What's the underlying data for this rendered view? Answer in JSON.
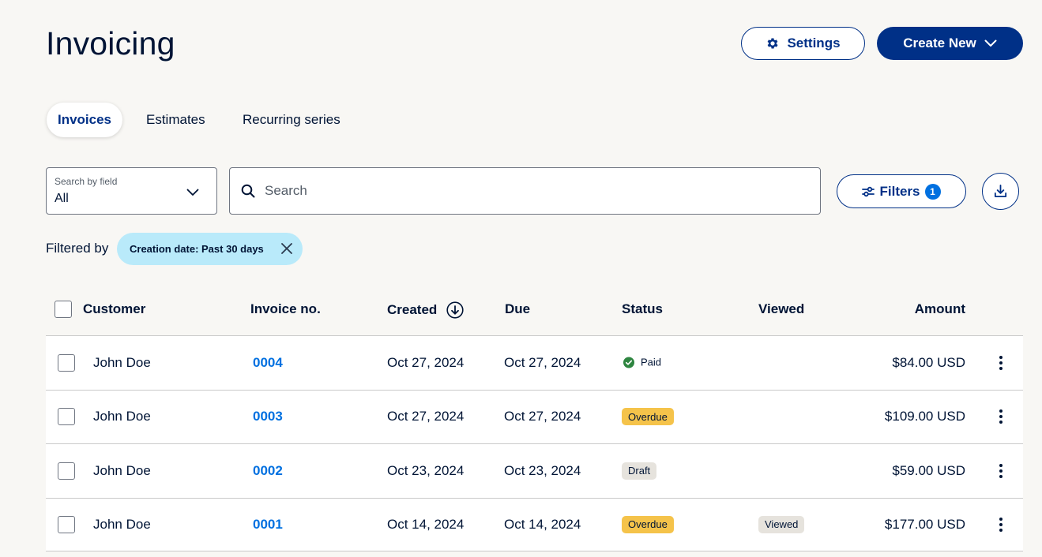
{
  "header": {
    "title": "Invoicing",
    "settings_label": "Settings",
    "create_label": "Create New"
  },
  "tabs": [
    {
      "label": "Invoices",
      "active": true
    },
    {
      "label": "Estimates",
      "active": false
    },
    {
      "label": "Recurring series",
      "active": false
    }
  ],
  "search": {
    "field_label": "Search by field",
    "field_value": "All",
    "placeholder": "Search",
    "filters_label": "Filters",
    "filters_count": "1"
  },
  "filter": {
    "label": "Filtered by",
    "chip": "Creation date: Past 30 days"
  },
  "table": {
    "headers": {
      "customer": "Customer",
      "invoice": "Invoice no.",
      "created": "Created",
      "due": "Due",
      "status": "Status",
      "viewed": "Viewed",
      "amount": "Amount"
    },
    "rows": [
      {
        "customer": "John Doe",
        "invoice": "0004",
        "created": "Oct 27, 2024",
        "due": "Oct 27, 2024",
        "status": "Paid",
        "viewed": "",
        "amount": "$84.00 USD"
      },
      {
        "customer": "John Doe",
        "invoice": "0003",
        "created": "Oct 27, 2024",
        "due": "Oct 27, 2024",
        "status": "Overdue",
        "viewed": "",
        "amount": "$109.00 USD"
      },
      {
        "customer": "John Doe",
        "invoice": "0002",
        "created": "Oct 23, 2024",
        "due": "Oct 23, 2024",
        "status": "Draft",
        "viewed": "",
        "amount": "$59.00 USD"
      },
      {
        "customer": "John Doe",
        "invoice": "0001",
        "created": "Oct 14, 2024",
        "due": "Oct 14, 2024",
        "status": "Overdue",
        "viewed": "Viewed",
        "amount": "$177.00 USD"
      }
    ]
  },
  "colors": {
    "brand": "#003087",
    "link": "#0070e0",
    "paid": "#2e8540",
    "overdue": "#f5c34a",
    "chip": "#b9eafa"
  },
  "icons": [
    "gear-icon",
    "chevron-down-icon",
    "search-icon",
    "filter-sliders-icon",
    "download-icon",
    "close-icon",
    "sort-down-icon",
    "kebab-menu-icon",
    "check-circle-icon"
  ]
}
